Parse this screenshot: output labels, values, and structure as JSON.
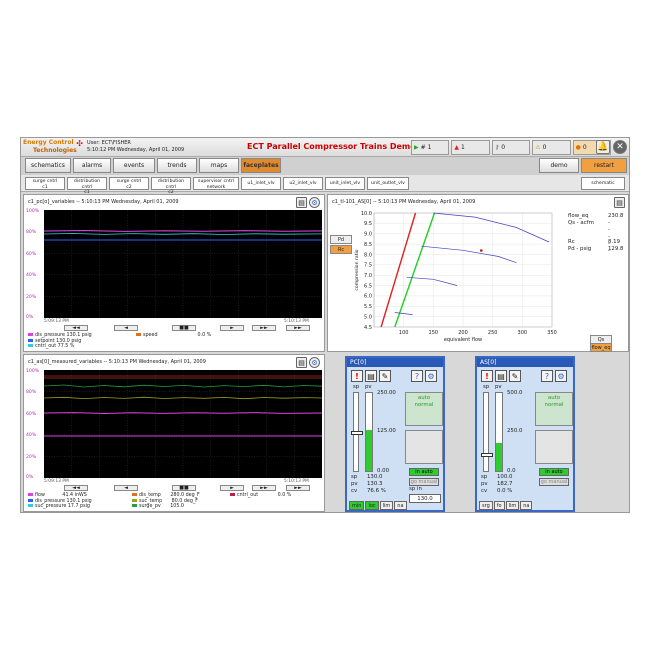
{
  "header": {
    "logo_line1": "Energy Control",
    "logo_line2": "Technologies",
    "user_label": "User: ECT\\FISHER",
    "datetime": "5:10:12 PM  Wednesday, April 01, 2009",
    "app_title": "ECT Parallel Compressor Trains Demo",
    "status": [
      {
        "icon": "flag-icon",
        "count": "1"
      },
      {
        "icon": "bell-alarm-icon",
        "count": "1"
      },
      {
        "icon": "key-icon",
        "count": "0"
      },
      {
        "icon": "warning-icon",
        "count": "0"
      },
      {
        "icon": "info-icon",
        "count": "0"
      }
    ]
  },
  "nav": {
    "items": [
      "schematics",
      "alarms",
      "events",
      "trends",
      "maps",
      "faceplates"
    ],
    "active": "faceplates",
    "demo": "demo",
    "restart": "restart"
  },
  "subnav": {
    "items": [
      [
        "surge cntrl",
        "c1"
      ],
      [
        "distribution cntrl",
        "c1"
      ],
      [
        "surge cntrl",
        "c2"
      ],
      [
        "distribution cntrl",
        "c2"
      ],
      [
        "supervisor cntrl",
        "network"
      ],
      [
        "u1_inlet_vlv",
        ""
      ],
      [
        "u2_inlet_vlv",
        ""
      ],
      [
        "unit_inlet_vlv",
        ""
      ],
      [
        "unit_outlet_vlv",
        ""
      ]
    ],
    "schematic": "schematic"
  },
  "trend1": {
    "title": "c1_pc[o]_variables  --  5:10:13 PM Wednesday, April 01, 2009",
    "yticks": [
      "100%",
      "80%",
      "60%",
      "40%",
      "20%",
      "0%"
    ],
    "t_start": "5:09:13 PM",
    "t_end": "5:10:13 PM",
    "legend": [
      {
        "name": "dis_pressure",
        "value": "130.1 psig",
        "color": "#e040e0"
      },
      {
        "name": "setpoint",
        "value": "130.0 psig",
        "color": "#3060ff"
      },
      {
        "name": "cntrl_out",
        "value": "77.5 %",
        "color": "#30d0e0"
      },
      {
        "name": "speed",
        "value": "0.0 %",
        "color": "#e07020"
      }
    ],
    "controls": [
      "◄◄",
      "◄",
      "■■",
      "►",
      "►►",
      "►►"
    ]
  },
  "trend2": {
    "title": "c1_as[0]_measured_variables  --  5:10:13 PM Wednesday, April 01, 2009",
    "yticks": [
      "100%",
      "80%",
      "60%",
      "40%",
      "20%",
      "0%"
    ],
    "t_start": "5:09:13 PM",
    "t_end": "5:10:13 PM",
    "legend": [
      {
        "name": "flow",
        "value": "41.4 inWS",
        "color": "#e040e0"
      },
      {
        "name": "dis_pressure",
        "value": "130.1 psig",
        "color": "#3060ff"
      },
      {
        "name": "suc_pressure",
        "value": "17.7 psig",
        "color": "#30d0e0"
      },
      {
        "name": "dis_temp",
        "value": "280.0 deg_F",
        "color": "#e07020"
      },
      {
        "name": "suc_temp",
        "value": "80.0 deg_F",
        "color": "#a0a020"
      },
      {
        "name": "surge_pv",
        "value": "105.0",
        "color": "#20a040"
      },
      {
        "name": "cntrl_out",
        "value": "0.0 %",
        "color": "#c02040"
      }
    ],
    "controls": [
      "◄◄",
      "◄",
      "■■",
      "►",
      "►►",
      "►►"
    ]
  },
  "surge_map": {
    "title": "c1_tl-101_AS[0]  --  5:10:13 PM Wednesday, April 01, 2009",
    "xlabel": "equivalent flow",
    "ylabel": "compression ratio",
    "readouts": [
      {
        "label": "flow_eq",
        "value": "230.8"
      },
      {
        "label": "Qs - acfm",
        "value": "-----"
      },
      {
        "label": "Rc",
        "value": "8.19"
      },
      {
        "label": "Pd - psig",
        "value": "129.8"
      }
    ],
    "side_buttons": [
      "Pd",
      "Rc"
    ],
    "bottom_buttons": [
      "Qs",
      "flow_eq"
    ]
  },
  "chart_data": {
    "type": "line",
    "xlim": [
      50,
      350
    ],
    "ylim": [
      4.5,
      10
    ],
    "xticks": [
      100,
      150,
      200,
      250,
      300,
      350
    ],
    "yticks": [
      4.5,
      5.0,
      5.5,
      6.0,
      6.5,
      7.0,
      7.5,
      8.0,
      8.5,
      9.0,
      9.5,
      10.0
    ],
    "series": [
      {
        "color": "#e02020",
        "points": [
          [
            62,
            4.5
          ],
          [
            120,
            10
          ]
        ]
      },
      {
        "color": "#20d020",
        "points": [
          [
            85,
            4.5
          ],
          [
            152,
            10
          ]
        ]
      },
      {
        "color": "#4040c0",
        "points": [
          [
            150,
            10
          ],
          [
            220,
            9.8
          ],
          [
            290,
            9.3
          ],
          [
            345,
            8.6
          ]
        ]
      },
      {
        "color": "#4040c0",
        "points": [
          [
            130,
            8.4
          ],
          [
            200,
            8.2
          ],
          [
            260,
            7.9
          ],
          [
            290,
            7.6
          ]
        ]
      },
      {
        "color": "#4040c0",
        "points": [
          [
            105,
            6.9
          ],
          [
            150,
            6.8
          ],
          [
            190,
            6.5
          ]
        ]
      },
      {
        "color": "#4040c0",
        "points": [
          [
            85,
            5.2
          ],
          [
            115,
            5.1
          ]
        ]
      }
    ],
    "marker": {
      "x": 230.8,
      "y": 8.19,
      "color": "#c03030"
    }
  },
  "pc": {
    "title": "PC[0]",
    "scale": [
      "250.00",
      "125.00",
      "0.00"
    ],
    "mode1": "auto",
    "mode2": "normal",
    "btn_auto": "in auto",
    "btn_manual": "go manual",
    "sp_label": "sp",
    "sp": "130.0",
    "pv_label": "pv",
    "pv": "130.3",
    "cv_label": "cv",
    "cv": "76.6",
    "cv_unit": "%",
    "spin_label": "sp in",
    "spin": "130.0",
    "modes": [
      "min",
      "loc",
      "lim",
      "na"
    ],
    "pv_fill": 0.52,
    "cv_fill": 0.766
  },
  "as": {
    "title": "AS[0]",
    "scale": [
      "500.0",
      "250.0",
      "0.0"
    ],
    "mode1": "auto",
    "mode2": "normal",
    "btn_auto": "in auto",
    "btn_manual": "go manual",
    "sp_label": "sp",
    "sp": "100.0",
    "pv_label": "pv",
    "pv": "182.7",
    "cv_label": "cv",
    "cv": "0.0",
    "cv_unit": "%",
    "modes": [
      "srg",
      "fo",
      "lim",
      "na"
    ],
    "pv_fill": 0.365,
    "cv_fill": 0.0
  }
}
